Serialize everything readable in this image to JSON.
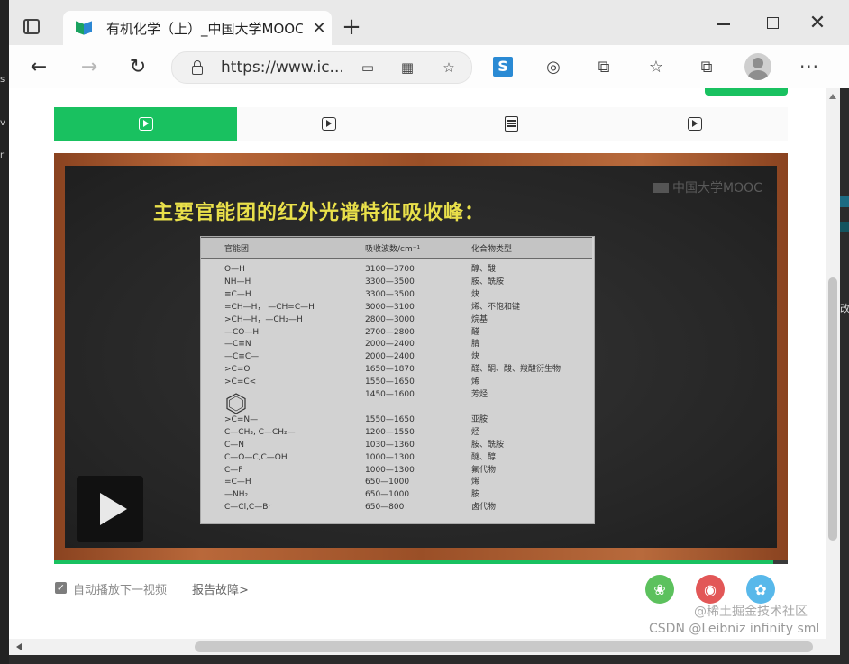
{
  "left_fragment": {
    "glyphs": [
      "s",
      "v",
      "r"
    ]
  },
  "right_fragment": {
    "glyph": "改"
  },
  "browser": {
    "tab_title": "有机化学（上）_中国大学MOOC",
    "tab_close": "✕",
    "new_tab": "+",
    "window_close": "✕",
    "url": "https://www.ic..."
  },
  "icons": {
    "back": "←",
    "forward": "→",
    "reload": "↻",
    "cast": "▭",
    "apps": "▦",
    "fav_add": "☆",
    "ext_s": "S",
    "reader": "◎",
    "puzzle": "⧉",
    "favorites": "☆",
    "collections": "⧉",
    "more": "···"
  },
  "colors": {
    "accent_green": "#19c160",
    "slide_title": "#e9e04a",
    "wechat": "#5cc15d",
    "weibo": "#e25757",
    "qq": "#58b8ea"
  },
  "video": {
    "watermark": "中国大学MOOC",
    "slide_title": "主要官能团的红外光谱特征吸收峰：",
    "table": {
      "headers": [
        "官能团",
        "吸收波数/cm⁻¹",
        "化合物类型"
      ],
      "rows": [
        [
          "O—H",
          "3100—3700",
          "醇、酸"
        ],
        [
          "NH—H",
          "3300—3500",
          "胺、酰胺"
        ],
        [
          "≡C—H",
          "3300—3500",
          "炔"
        ],
        [
          "=CH—H，  —CH=C—H",
          "3000—3100",
          "烯、不饱和键"
        ],
        [
          ">CH—H，—CH₂—H",
          "2800—3000",
          "烷基"
        ],
        [
          "—CO—H",
          "2700—2800",
          "醛"
        ],
        [
          "—C≡N",
          "2000—2400",
          "腈"
        ],
        [
          "—C≡C—",
          "2000—2400",
          "炔"
        ],
        [
          ">C=O",
          "1650—1870",
          "醛、酮、酸、羧酸衍生物"
        ],
        [
          ">C=C<",
          "1550—1650",
          "烯"
        ],
        [
          "",
          "1450—1600",
          "芳烃"
        ],
        [
          ">C=N—",
          "1550—1650",
          "亚胺"
        ],
        [
          "C—CH₃, C—CH₂—",
          "1200—1550",
          "烃"
        ],
        [
          "C—N",
          "1030—1360",
          "胺、酰胺"
        ],
        [
          "C—O—C,C—OH",
          "1000—1300",
          "醚、醇"
        ],
        [
          "C—F",
          "1000—1300",
          "氟代物"
        ],
        [
          "=C—H",
          "650—1000",
          "烯"
        ],
        [
          "—NH₂",
          "650—1000",
          "胺"
        ],
        [
          "C—Cl,C—Br",
          "650—800",
          "卤代物"
        ]
      ]
    },
    "progress": 0.98
  },
  "below_player": {
    "checkmark": "✓",
    "autoplay_label": "自动播放下一视频",
    "report_link": "报告故障>",
    "share_wechat": "❀",
    "share_weibo": "◉",
    "share_qq": "✿"
  },
  "watermarks": {
    "juejin": "@稀土掘金技术社区",
    "csdn": "CSDN @Leibniz infinity sml"
  }
}
